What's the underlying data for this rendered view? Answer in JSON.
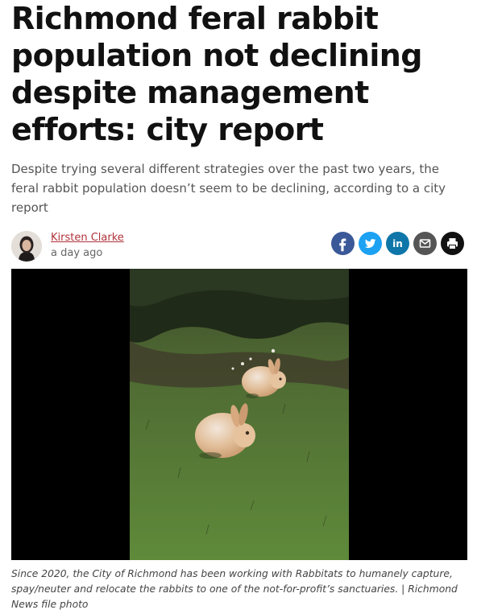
{
  "article": {
    "headline": "Richmond feral rabbit population not declining despite management efforts: city report",
    "dek": "Despite trying several different strategies over the past two years, the feral rabbit population doesn’t seem to be declining, according to a city report"
  },
  "byline": {
    "author": "Kirsten Clarke",
    "timestamp": "a day ago"
  },
  "share": {
    "buttons": [
      {
        "icon": "facebook-icon",
        "color": "#3b5998"
      },
      {
        "icon": "twitter-icon",
        "color": "#1da1f2"
      },
      {
        "icon": "linkedin-icon",
        "color": "#0e76a8"
      },
      {
        "icon": "email-icon",
        "color": "#555555"
      },
      {
        "icon": "print-icon",
        "color": "#111111"
      }
    ]
  },
  "photo": {
    "subject": "two rabbits on grass"
  },
  "caption": {
    "text": "Since 2020, the City of Richmond has been working with Rabbitats to humanely capture, spay/neuter and relocate the rabbits to one of the not-for-profit’s sanctuaries.",
    "credit": " | Richmond News file photo"
  }
}
